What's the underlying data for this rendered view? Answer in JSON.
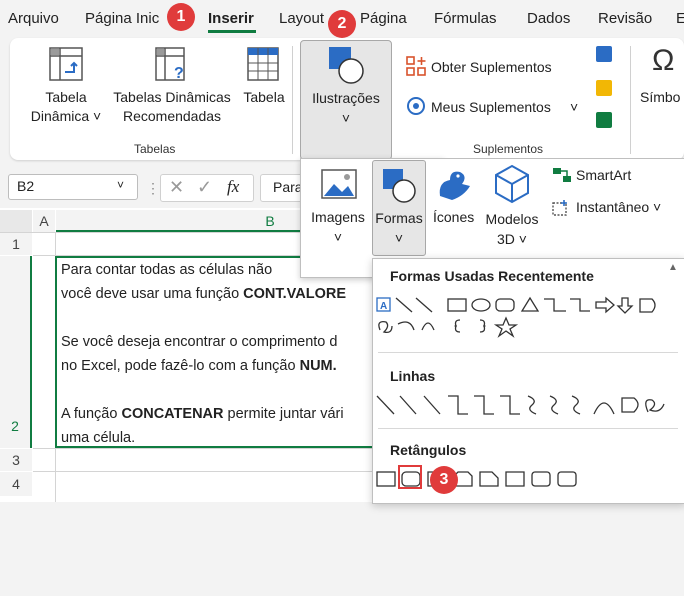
{
  "menu": {
    "items": [
      "Arquivo",
      "Página Inic",
      "Inserir",
      "Layout",
      "Página",
      "Fórmulas",
      "Dados",
      "Revisão",
      "E"
    ],
    "active": "Inserir"
  },
  "badges": {
    "b1": "1",
    "b2": "2",
    "b3": "3"
  },
  "ribbon": {
    "tabela_dinamica": [
      "Tabela",
      "Dinâmica ˅"
    ],
    "tabelas_recomendadas": [
      "Tabelas Dinâmicas",
      "Recomendadas"
    ],
    "tabela": "Tabela",
    "tabelas_group": "Tabelas",
    "ilustracoes": "Ilustrações",
    "chevron": "˅",
    "obter_suplementos": "Obter Suplementos",
    "meus_suplementos": "Meus Suplementos",
    "suplementos_group": "Suplementos",
    "simbolos": "Símbo"
  },
  "formula_bar": {
    "name_box": "B2",
    "fx": "fx",
    "content": "Para"
  },
  "grid": {
    "columns": [
      "A",
      "B"
    ],
    "rows": [
      "1",
      "2",
      "3",
      "4"
    ],
    "lines": [
      {
        "pre": "Para contar todas as células não",
        "bold": "",
        "post": ""
      },
      {
        "pre": "você deve usar uma função ",
        "bold": "CONT.VALORE",
        "post": ""
      },
      {
        "pre": "",
        "bold": "",
        "post": ""
      },
      {
        "pre": "Se você deseja encontrar o comprimento d",
        "bold": "",
        "post": ""
      },
      {
        "pre": "no Excel, pode fazê-lo com a função ",
        "bold": "NUM.",
        "post": ""
      },
      {
        "pre": "",
        "bold": "",
        "post": ""
      },
      {
        "pre": "A função ",
        "bold": "CONCATENAR",
        "post": " permite juntar vári"
      },
      {
        "pre": "uma célula.",
        "bold": "",
        "post": ""
      }
    ]
  },
  "illustrations_menu": {
    "imagens": "Imagens",
    "formas": "Formas",
    "icones": "Ícones",
    "modelos": [
      "Modelos",
      "3D ˅"
    ],
    "smartart": "SmartArt",
    "instantaneo": "Instantâneo ˅"
  },
  "shapes_panel": {
    "recent": "Formas Usadas Recentemente",
    "lines": "Linhas",
    "rectangles": "Retângulos"
  },
  "colors": {
    "accent": "#107c41",
    "badge": "#e03b3b",
    "icon_blue": "#2b6cc4",
    "highlight": "#e03b3b"
  }
}
